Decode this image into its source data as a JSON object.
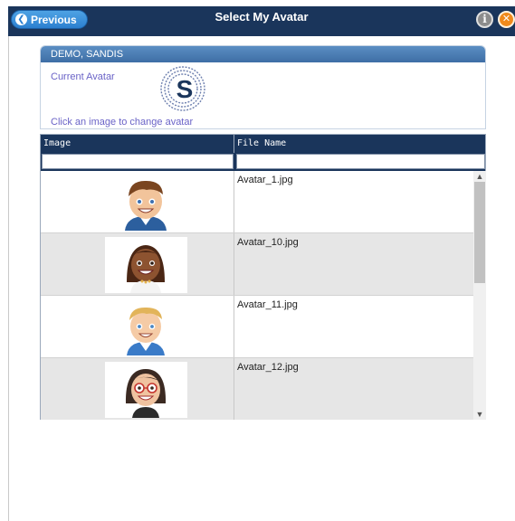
{
  "header": {
    "previous_label": "Previous",
    "title": "Select My Avatar",
    "info_glyph": "i",
    "close_glyph": "✕"
  },
  "user_panel": {
    "name": "DEMO, SANDIS",
    "current_avatar_label": "Current Avatar",
    "change_hint": "Click an image to change avatar"
  },
  "grid": {
    "columns": [
      "Image",
      "File Name"
    ],
    "filter_image_value": "",
    "filter_name_value": "",
    "rows": [
      {
        "file": "Avatar_1.jpg",
        "icon": "avatar-boy-brown-hair-icon"
      },
      {
        "file": "Avatar_10.jpg",
        "icon": "avatar-girl-dark-skin-icon"
      },
      {
        "file": "Avatar_11.jpg",
        "icon": "avatar-boy-blond-icon"
      },
      {
        "file": "Avatar_12.jpg",
        "icon": "avatar-woman-glasses-icon"
      }
    ]
  },
  "colors": {
    "header_bg": "#1a355b",
    "accent_blue": "#2b7fd0",
    "close_orange": "#f08a1c",
    "label_purple": "#6a63c7"
  }
}
